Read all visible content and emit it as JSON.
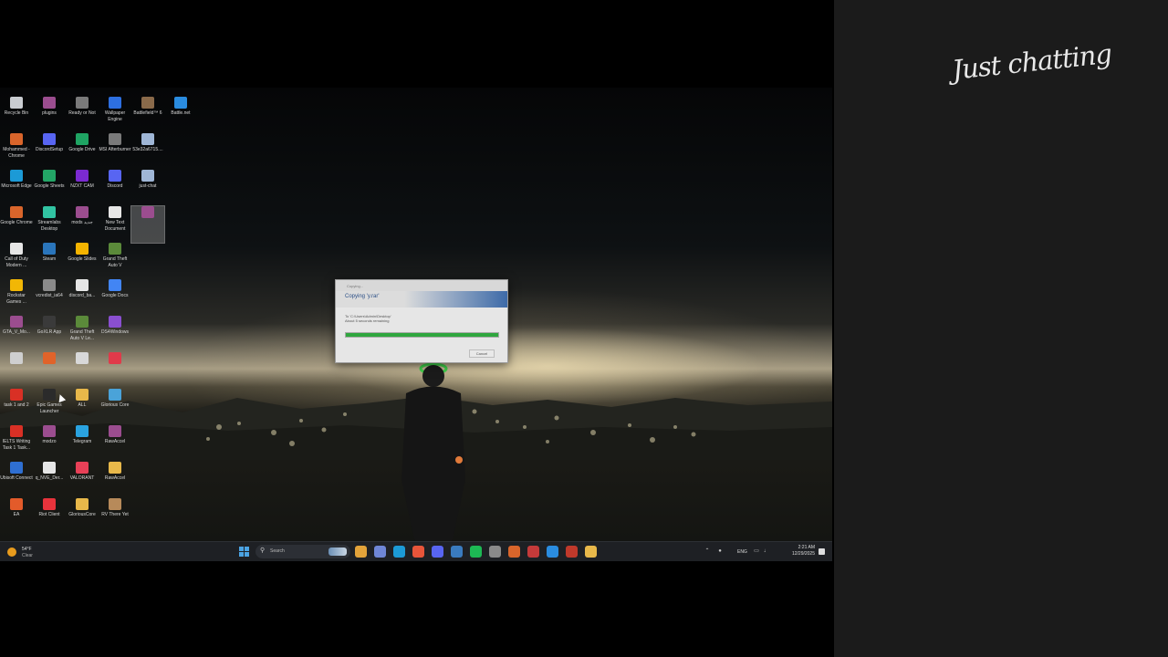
{
  "overlay": {
    "title": "Just chatting"
  },
  "desktop_icons": [
    {
      "label": "Recycle Bin",
      "icon": "recycle-bin-icon",
      "color": "#c9ccd1"
    },
    {
      "label": "plugins",
      "icon": "winrar-icon",
      "color": "#9b4d8f"
    },
    {
      "label": "Ready or Not",
      "icon": "ready-or-not-icon",
      "color": "#7a7a7a"
    },
    {
      "label": "Wallpaper Engine",
      "icon": "wallpaper-engine-icon",
      "color": "#2d6fe0"
    },
    {
      "label": "Battlefield™ 6",
      "icon": "battlefield-icon",
      "color": "#8a6a4a"
    },
    {
      "label": "Battle.net",
      "icon": "battlenet-icon",
      "color": "#2a8ce0"
    },
    {
      "label": "Mohammed - Chrome",
      "icon": "chrome-profile-icon",
      "color": "#d9652b"
    },
    {
      "label": "DiscordSetup",
      "icon": "discord-icon",
      "color": "#5865f2"
    },
    {
      "label": "Google Drive",
      "icon": "google-drive-icon",
      "color": "#1fa463"
    },
    {
      "label": "MSI Afterburner",
      "icon": "msi-afterburner-icon",
      "color": "#7a7a7a"
    },
    {
      "label": "53e32a6715....",
      "icon": "file-icon",
      "color": "#9fb6d6"
    },
    {
      "label": "Microsoft Edge",
      "icon": "edge-icon",
      "color": "#1c9ad6"
    },
    {
      "label": "Google Sheets",
      "icon": "google-sheets-icon",
      "color": "#23a566"
    },
    {
      "label": "NZXT CAM",
      "icon": "nzxt-cam-icon",
      "color": "#7b2ad1"
    },
    {
      "label": "Discord",
      "icon": "discord-icon",
      "color": "#5865f2"
    },
    {
      "label": "just-chat",
      "icon": "file-icon",
      "color": "#9fb6d6"
    },
    {
      "label": "Google Chrome",
      "icon": "chrome-icon",
      "color": "#d9652b"
    },
    {
      "label": "Streamlabs Desktop",
      "icon": "streamlabs-icon",
      "color": "#31c3a2"
    },
    {
      "label": "mods جديد",
      "icon": "winrar-icon",
      "color": "#9b4d8f"
    },
    {
      "label": "New Text Document",
      "icon": "text-document-icon",
      "color": "#e6e6e6"
    },
    {
      "label": "",
      "icon": "winrar-icon",
      "color": "#9b4d8f"
    },
    {
      "label": "Call of Duty Modern ...",
      "icon": "document-icon",
      "color": "#e6e6e6"
    },
    {
      "label": "Steam",
      "icon": "steam-icon",
      "color": "#2a75bb"
    },
    {
      "label": "Google Slides",
      "icon": "google-slides-icon",
      "color": "#f4b400"
    },
    {
      "label": "Grand Theft Auto V",
      "icon": "gta-v-icon",
      "color": "#5b8a3a"
    },
    {
      "label": "Rockstar Games ...",
      "icon": "rockstar-icon",
      "color": "#f2b705"
    },
    {
      "label": "vcredist_ia64",
      "icon": "installer-icon",
      "color": "#8a8a8a"
    },
    {
      "label": "discord_ba...",
      "icon": "document-icon",
      "color": "#e6e6e6"
    },
    {
      "label": "Google Docs",
      "icon": "google-docs-icon",
      "color": "#4285f4"
    },
    {
      "label": "GTA_V_Mo...",
      "icon": "winrar-icon",
      "color": "#9b4d8f"
    },
    {
      "label": "GoXLR App",
      "icon": "goxlr-icon",
      "color": "#3a3a3a"
    },
    {
      "label": "Grand Theft Auto V Le...",
      "icon": "gta-v-icon",
      "color": "#5b8a3a"
    },
    {
      "label": "DS4Windows",
      "icon": "ds4windows-icon",
      "color": "#8a4fd0"
    },
    {
      "label": "",
      "icon": "app-icon",
      "color": "#cfcfcf"
    },
    {
      "label": "",
      "icon": "app-icon",
      "color": "#e0632a"
    },
    {
      "label": "",
      "icon": "app-icon",
      "color": "#d8d8d8"
    },
    {
      "label": "",
      "icon": "app-icon",
      "color": "#e03a4a"
    },
    {
      "label": "task 1 and 2",
      "icon": "pdf-icon",
      "color": "#d93025"
    },
    {
      "label": "Epic Games Launcher",
      "icon": "epic-games-icon",
      "color": "#2b2b2b"
    },
    {
      "label": "ALL",
      "icon": "folder-icon",
      "color": "#e8b84a"
    },
    {
      "label": "Glorious Core",
      "icon": "glorious-core-icon",
      "color": "#4aa3d9"
    },
    {
      "label": "IELTS Writing Task 1 Task...",
      "icon": "pdf-icon",
      "color": "#d93025"
    },
    {
      "label": "modzo",
      "icon": "winrar-icon",
      "color": "#9b4d8f"
    },
    {
      "label": "Telegram",
      "icon": "telegram-icon",
      "color": "#2aa3e0"
    },
    {
      "label": "RawAccel",
      "icon": "winrar-icon",
      "color": "#9b4d8f"
    },
    {
      "label": "Ubisoft Connect",
      "icon": "ubisoft-icon",
      "color": "#2f6fd1"
    },
    {
      "label": "q_NVE_Der...",
      "icon": "document-icon",
      "color": "#e6e6e6"
    },
    {
      "label": "VALORANT",
      "icon": "valorant-icon",
      "color": "#e84057"
    },
    {
      "label": "RawAccel",
      "icon": "folder-icon",
      "color": "#e8b84a"
    },
    {
      "label": "EA",
      "icon": "ea-icon",
      "color": "#e35b2a"
    },
    {
      "label": "Riot Client",
      "icon": "riot-client-icon",
      "color": "#e8333c"
    },
    {
      "label": "GloriousCore",
      "icon": "folder-icon",
      "color": "#e8b84a"
    },
    {
      "label": "RV There Yet",
      "icon": "rv-there-yet-icon",
      "color": "#b78a5a"
    }
  ],
  "copy_dialog": {
    "title": "Copying...",
    "heading": "Copying 'y.rar'",
    "destination": "To 'C:\\Users\\Admin\\Desktop'",
    "remaining": "About 5 seconds remaining",
    "progress": 1.0,
    "cancel_label": "Cancel"
  },
  "taskbar": {
    "weather_temp": "54°F",
    "weather_condition": "Clear",
    "search_placeholder": "Search",
    "apps": [
      {
        "name": "file-explorer-icon",
        "color": "#e3a33a"
      },
      {
        "name": "copilot-icon",
        "color": "#6f86d6"
      },
      {
        "name": "edge-icon",
        "color": "#1c9ad6"
      },
      {
        "name": "brave-icon",
        "color": "#e8553a"
      },
      {
        "name": "discord-icon",
        "color": "#5865f2"
      },
      {
        "name": "steam-icon",
        "color": "#3a7bbf"
      },
      {
        "name": "spotify-icon",
        "color": "#1db954"
      },
      {
        "name": "obs-icon",
        "color": "#8a8a8a"
      },
      {
        "name": "chrome-icon",
        "color": "#d9652b"
      },
      {
        "name": "msi-afterburner-icon",
        "color": "#c53a3a"
      },
      {
        "name": "battlenet-icon",
        "color": "#2a8ce0"
      },
      {
        "name": "streamlabs-icon",
        "color": "#c0392b"
      },
      {
        "name": "folder-icon",
        "color": "#e8b84a"
      }
    ],
    "language": "ENG",
    "time": "2:21 AM",
    "date": "12/29/2025"
  }
}
